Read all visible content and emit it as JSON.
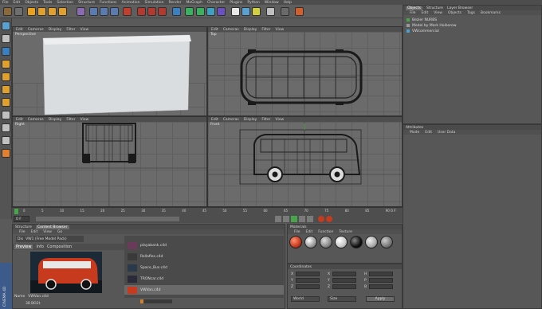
{
  "menu": [
    "File",
    "Edit",
    "Objects",
    "Tools",
    "Selection",
    "Structure",
    "Functions",
    "Animation",
    "Simulation",
    "Render",
    "MoGraph",
    "Character",
    "Plugins",
    "Python",
    "Window",
    "Help"
  ],
  "viewports": {
    "menu": [
      "Edit",
      "Cameras",
      "Display",
      "Filter",
      "View"
    ],
    "perspective": "Perspective",
    "top": "Top",
    "right": "Right",
    "front": "Front"
  },
  "objects_panel": {
    "tabs": [
      "Objects",
      "Structure",
      "Layer Browser"
    ],
    "menu": [
      "File",
      "Edit",
      "View",
      "Objects",
      "Tags",
      "Bookmarks"
    ],
    "items": [
      "Bezier NURBS",
      "Model by Mark Hoiborow",
      "VWcommercial"
    ]
  },
  "attributes_panel": {
    "title": "Attributes",
    "menu": [
      "Mode",
      "Edit",
      "User Data"
    ]
  },
  "timeline": {
    "ticks": [
      "0",
      "5",
      "10",
      "15",
      "20",
      "25",
      "30",
      "35",
      "40",
      "45",
      "50",
      "55",
      "60",
      "65",
      "70",
      "75",
      "80",
      "85",
      "90"
    ],
    "frame_start": "0 F",
    "frame_end": "0 F"
  },
  "browser": {
    "tabs": [
      "Structure",
      "Content Browser"
    ],
    "menu": [
      "File",
      "Edit",
      "View",
      "Go"
    ],
    "search_label": "Dis",
    "path": "VW1 (Free Model Pack)",
    "preview_tabs": [
      "Preview",
      "Info",
      "Composition"
    ],
    "files": [
      "playabank.c4d",
      "Rollafles.c4d",
      "Space_Bus.c4d",
      "TRONcar.c4d",
      "VWVan.c4d"
    ],
    "name_label": "Name",
    "name_value": "VWVan.c4d",
    "size_label": "38 BO2t"
  },
  "materials": {
    "title": "Materials",
    "menu": [
      "File",
      "Edit",
      "Function",
      "Texture"
    ]
  },
  "coordinates": {
    "title": "Coordinates",
    "labels": [
      "X",
      "Y",
      "Z",
      "X",
      "Y",
      "Z",
      "H",
      "P",
      "B"
    ],
    "world_label": "World",
    "size_label": "Size",
    "apply_label": "Apply"
  },
  "colors": {
    "viewport_bg": "#6b6b6b",
    "panel_bg": "#575757",
    "accent_red": "#c73a1e",
    "accent_green": "#46a64a"
  },
  "side_label": "CINEMA 4D"
}
